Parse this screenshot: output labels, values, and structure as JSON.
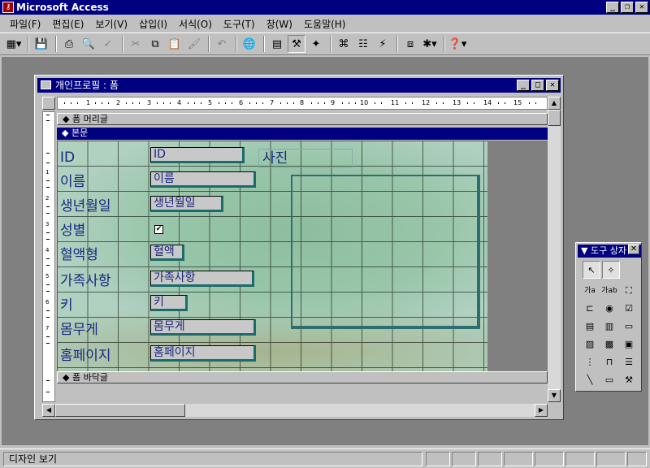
{
  "app": {
    "title": "Microsoft Access"
  },
  "menu": [
    "파일(F)",
    "편집(E)",
    "보기(V)",
    "삽입(I)",
    "서식(O)",
    "도구(T)",
    "창(W)",
    "도움말(H)"
  ],
  "toolbar": {
    "icons": [
      "view-icon",
      "save-icon",
      "print-icon",
      "print-preview-icon",
      "spelling-icon",
      "cut-icon",
      "copy-icon",
      "paste-icon",
      "format-painter-icon",
      "undo-icon",
      "insert-hyperlink-icon",
      "field-list-icon",
      "toolbox-icon",
      "autoformat-icon",
      "code-icon",
      "properties-icon",
      "build-icon",
      "database-window-icon",
      "new-object-icon",
      "help-icon"
    ]
  },
  "form_window": {
    "title": "개인프로필 : 폼",
    "sections": {
      "header": "폼 머리글",
      "detail": "본문",
      "footer": "폼 바닥글"
    },
    "ruler": [
      "1",
      "2",
      "3",
      "4",
      "5",
      "6",
      "7",
      "8",
      "9",
      "10",
      "11",
      "12",
      "13",
      "14",
      "15"
    ],
    "vruler": [
      "1",
      "2",
      "3",
      "4",
      "5",
      "6",
      "7"
    ],
    "labels": [
      "ID",
      "이름",
      "생년월일",
      "성별",
      "혈액형",
      "가족사항",
      "키",
      "몸무게",
      "홈페이지"
    ],
    "textboxes": [
      "ID",
      "이름",
      "생년월일",
      "혈액",
      "가족사항",
      "키",
      "몸무게",
      "홈페이지"
    ],
    "photo_label": "사진",
    "gender_checked": "✔"
  },
  "toolbox": {
    "title": "도구 상자",
    "tools": [
      "select-objects-icon",
      "control-wizards-icon",
      "label-icon",
      "textbox-icon",
      "option-group-icon",
      "toggle-button-icon",
      "option-button-icon",
      "checkbox-icon",
      "combo-box-icon",
      "list-box-icon",
      "command-button-icon",
      "image-icon",
      "unbound-object-icon",
      "bound-object-icon",
      "page-break-icon",
      "tab-control-icon",
      "subform-icon",
      "line-icon",
      "rectangle-icon",
      "more-controls-icon"
    ],
    "label_glyph": "가a",
    "textbox_glyph": "가ab"
  },
  "status": {
    "text": "디자인 보기"
  }
}
